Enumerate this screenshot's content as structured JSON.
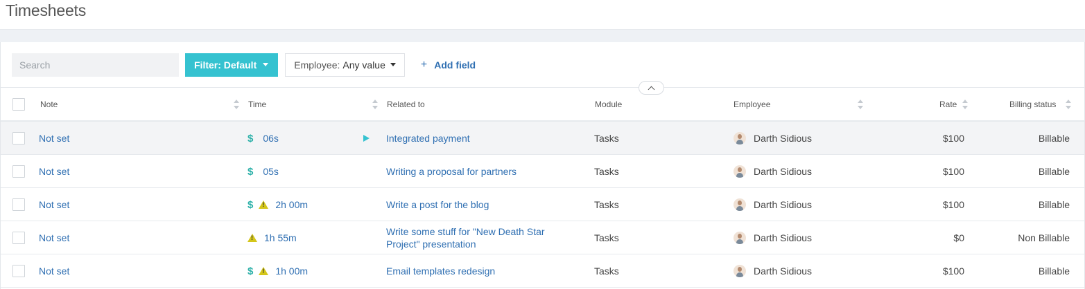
{
  "page": {
    "title": "Timesheets"
  },
  "toolbar": {
    "search_placeholder": "Search",
    "filter_label": "Filter: Default",
    "employee_label": "Employee:",
    "employee_value": "Any value",
    "add_field_label": "Add field"
  },
  "table": {
    "headers": {
      "note": "Note",
      "time": "Time",
      "related": "Related to",
      "module": "Module",
      "employee": "Employee",
      "rate": "Rate",
      "billing": "Billing status"
    },
    "rows": [
      {
        "note": "Not set",
        "billable_icon": true,
        "warning": false,
        "time": "06s",
        "playing": true,
        "related": "Integrated payment",
        "related2": "",
        "module": "Tasks",
        "employee": "Darth Sidious",
        "rate": "$100",
        "billing": "Billable"
      },
      {
        "note": "Not set",
        "billable_icon": true,
        "warning": false,
        "time": "05s",
        "playing": false,
        "related": "Writing a proposal for partners",
        "related2": "",
        "module": "Tasks",
        "employee": "Darth Sidious",
        "rate": "$100",
        "billing": "Billable"
      },
      {
        "note": "Not set",
        "billable_icon": true,
        "warning": true,
        "time": "2h 00m",
        "playing": false,
        "related": "Write a post for the blog",
        "related2": "",
        "module": "Tasks",
        "employee": "Darth Sidious",
        "rate": "$100",
        "billing": "Billable"
      },
      {
        "note": "Not set",
        "billable_icon": false,
        "warning": true,
        "time": "1h 55m",
        "playing": false,
        "related": "Write some stuff for \"New Death Star",
        "related2": "Project\" presentation",
        "module": "Tasks",
        "employee": "Darth Sidious",
        "rate": "$0",
        "billing": "Non Billable"
      },
      {
        "note": "Not set",
        "billable_icon": true,
        "warning": true,
        "time": "1h 00m",
        "playing": false,
        "related": "Email templates redesign",
        "related2": "",
        "module": "Tasks",
        "employee": "Darth Sidious",
        "rate": "$100",
        "billing": "Billable"
      }
    ]
  },
  "colors": {
    "accent": "#35c2d0",
    "link": "#2f6fb2",
    "dollar": "#2bb0a8",
    "warning": "#d4c61a"
  }
}
